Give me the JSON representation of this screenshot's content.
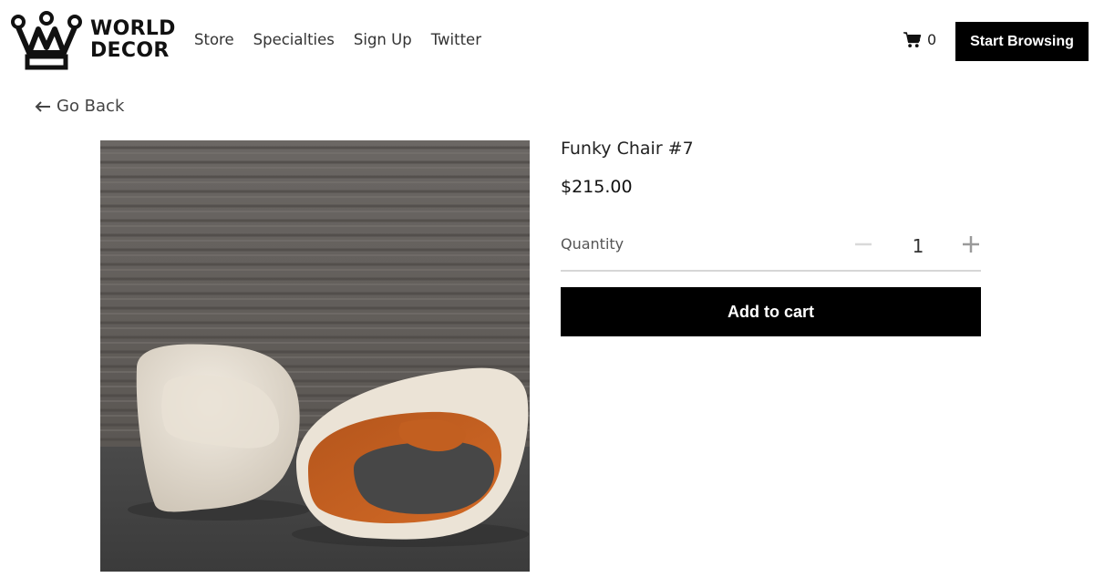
{
  "brand": {
    "line1": "WORLD",
    "line2": "DECOR",
    "logo_icon": "crown-icon"
  },
  "nav": {
    "items": [
      {
        "label": "Store"
      },
      {
        "label": "Specialties"
      },
      {
        "label": "Sign Up"
      },
      {
        "label": "Twitter"
      }
    ]
  },
  "cart": {
    "icon": "cart-icon",
    "count": "0"
  },
  "header": {
    "cta_label": "Start Browsing"
  },
  "back": {
    "icon": "arrow-left-icon",
    "label": "Go Back"
  },
  "product": {
    "title": "Funky Chair #7",
    "price": "$215.00",
    "quantity_label": "Quantity",
    "quantity": "1",
    "add_to_cart_label": "Add to cart"
  },
  "colors": {
    "primary": "#000000",
    "primary_text": "#ffffff",
    "divider": "#d6d6d6",
    "qty_minus_disabled": "#d9d9d9",
    "qty_plus": "#9a9a9a"
  }
}
